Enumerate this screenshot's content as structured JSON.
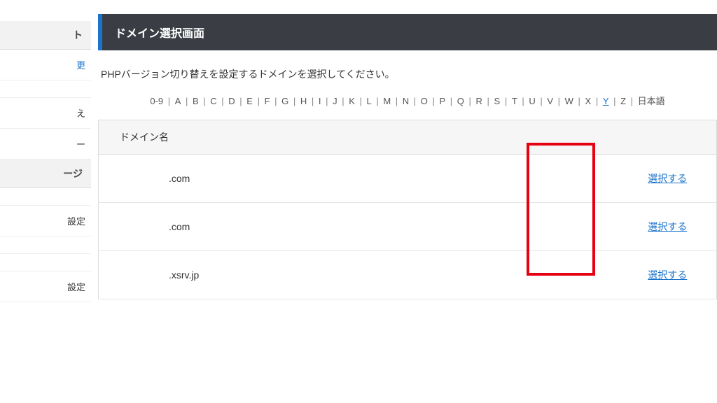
{
  "sidebar": {
    "section1_header": "ト",
    "items1": [
      "更"
    ],
    "items2": [
      "",
      "え",
      "ー"
    ],
    "section2_header": "ージ",
    "items3": [
      "",
      "設定",
      "",
      "",
      "設定"
    ]
  },
  "page_title": "ドメイン選択画面",
  "instruction": "PHPバージョン切り替えを設定するドメインを選択してください。",
  "alpha_nav": {
    "items": [
      "0-9",
      "A",
      "B",
      "C",
      "D",
      "E",
      "F",
      "G",
      "H",
      "I",
      "J",
      "K",
      "L",
      "M",
      "N",
      "O",
      "P",
      "Q",
      "R",
      "S",
      "T",
      "U",
      "V",
      "W",
      "X",
      "Y",
      "Z",
      "日本語"
    ],
    "active": "Y"
  },
  "table": {
    "header_domain": "ドメイン名",
    "header_action": "",
    "rows": [
      {
        "domain": ".com",
        "action": "選択する"
      },
      {
        "domain": ".com",
        "action": "選択する"
      },
      {
        "domain": ".xsrv.jp",
        "action": "選択する"
      }
    ]
  }
}
